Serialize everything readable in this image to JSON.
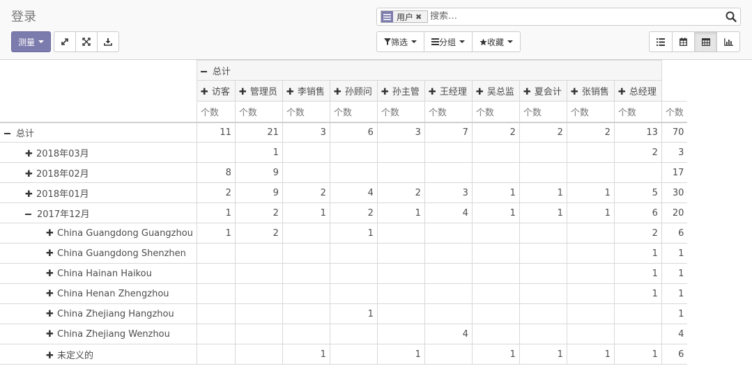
{
  "page": {
    "title": "登录"
  },
  "search": {
    "facet_value": "用户",
    "placeholder": "搜索…"
  },
  "toolbar": {
    "measures_label": "测量",
    "filters_label": "筛选",
    "groupby_label": "分组",
    "favorites_label": "收藏"
  },
  "pivot": {
    "top_header": "总计",
    "columns": [
      "访客",
      "管理员",
      "李销售",
      "孙顾问",
      "孙主管",
      "王经理",
      "吴总监",
      "夏会计",
      "张销售",
      "总经理"
    ],
    "measure_label": "个数",
    "rows": [
      {
        "label": "总计",
        "level": 0,
        "sign": "minus",
        "values": [
          "11",
          "21",
          "3",
          "6",
          "3",
          "7",
          "2",
          "2",
          "2",
          "13"
        ],
        "total": "70",
        "bold_values": true
      },
      {
        "label": "2018年03月",
        "level": 1,
        "sign": "plus",
        "values": [
          "",
          "1",
          "",
          "",
          "",
          "",
          "",
          "",
          "",
          "2"
        ],
        "total": "3",
        "bold_values": false
      },
      {
        "label": "2018年02月",
        "level": 1,
        "sign": "plus",
        "values": [
          "8",
          "9",
          "",
          "",
          "",
          "",
          "",
          "",
          "",
          ""
        ],
        "total": "17",
        "bold_values": false
      },
      {
        "label": "2018年01月",
        "level": 1,
        "sign": "plus",
        "values": [
          "2",
          "9",
          "2",
          "4",
          "2",
          "3",
          "1",
          "1",
          "1",
          "5"
        ],
        "total": "30",
        "bold_values": false
      },
      {
        "label": "2017年12月",
        "level": 1,
        "sign": "minus",
        "values": [
          "1",
          "2",
          "1",
          "2",
          "1",
          "4",
          "1",
          "1",
          "1",
          "6"
        ],
        "total": "20",
        "bold_values": false
      },
      {
        "label": "China Guangdong Guangzhou",
        "level": 2,
        "sign": "plus",
        "values": [
          "1",
          "2",
          "",
          "1",
          "",
          "",
          "",
          "",
          "",
          "2"
        ],
        "total": "6",
        "bold_values": false
      },
      {
        "label": "China Guangdong Shenzhen",
        "level": 2,
        "sign": "plus",
        "values": [
          "",
          "",
          "",
          "",
          "",
          "",
          "",
          "",
          "",
          "1"
        ],
        "total": "1",
        "bold_values": false
      },
      {
        "label": "China Hainan Haikou",
        "level": 2,
        "sign": "plus",
        "values": [
          "",
          "",
          "",
          "",
          "",
          "",
          "",
          "",
          "",
          "1"
        ],
        "total": "1",
        "bold_values": false
      },
      {
        "label": "China Henan Zhengzhou",
        "level": 2,
        "sign": "plus",
        "values": [
          "",
          "",
          "",
          "",
          "",
          "",
          "",
          "",
          "",
          "1"
        ],
        "total": "1",
        "bold_values": false
      },
      {
        "label": "China Zhejiang Hangzhou",
        "level": 2,
        "sign": "plus",
        "values": [
          "",
          "",
          "",
          "1",
          "",
          "",
          "",
          "",
          "",
          ""
        ],
        "total": "1",
        "bold_values": false
      },
      {
        "label": "China Zhejiang Wenzhou",
        "level": 2,
        "sign": "plus",
        "values": [
          "",
          "",
          "",
          "",
          "",
          "4",
          "",
          "",
          "",
          ""
        ],
        "total": "4",
        "bold_values": false
      },
      {
        "label": "未定义的",
        "level": 2,
        "sign": "plus",
        "values": [
          "",
          "",
          "1",
          "",
          "1",
          "",
          "1",
          "1",
          "1",
          "1"
        ],
        "total": "6",
        "bold_values": false
      }
    ]
  },
  "colors": {
    "primary": "#7c7bad"
  }
}
